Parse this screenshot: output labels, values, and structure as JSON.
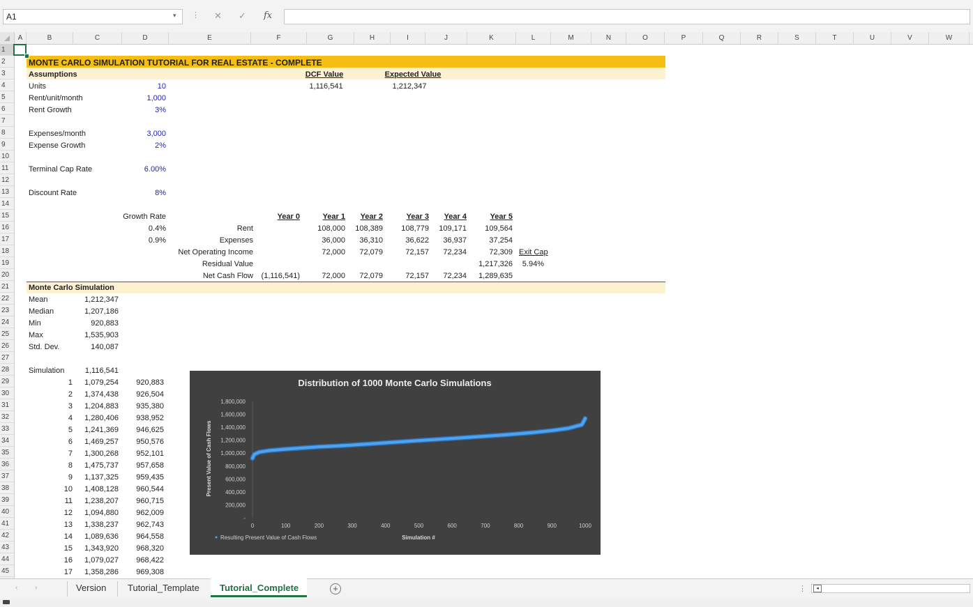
{
  "namebox": "A1",
  "formula": {
    "fx": "fx",
    "cancel_icon": "✕",
    "enter_icon": "✓",
    "value": ""
  },
  "columns": [
    "A",
    "B",
    "C",
    "D",
    "E",
    "F",
    "G",
    "H",
    "I",
    "J",
    "K",
    "L",
    "M",
    "N",
    "O",
    "P",
    "Q",
    "R",
    "S",
    "T",
    "U",
    "V",
    "W"
  ],
  "rows": [
    "1",
    "2",
    "3",
    "4",
    "5",
    "6",
    "7",
    "8",
    "9",
    "10",
    "11",
    "12",
    "13",
    "14",
    "15",
    "16",
    "17",
    "18",
    "19",
    "20",
    "21",
    "22",
    "23",
    "24",
    "25",
    "26",
    "27",
    "28",
    "29",
    "30",
    "31",
    "32",
    "33",
    "34",
    "35",
    "36",
    "37",
    "38",
    "39",
    "40",
    "41",
    "42",
    "43",
    "44",
    "45"
  ],
  "sheet": {
    "title": "MONTE CARLO SIMULATION TUTORIAL FOR REAL ESTATE - COMPLETE",
    "assumptions_header": "Assumptions",
    "dcf_label": "DCF Value",
    "dcf_value": "1,116,541",
    "expected_label": "Expected Value",
    "expected_value": "1,212,347",
    "assumptions": [
      {
        "label": "Units",
        "value": "10"
      },
      {
        "label": "Rent/unit/month",
        "value": "1,000"
      },
      {
        "label": "Rent Growth",
        "value": "3%"
      },
      {
        "label": "Expenses/month",
        "value": "3,000"
      },
      {
        "label": "Expense Growth",
        "value": "2%"
      },
      {
        "label": "Terminal Cap Rate",
        "value": "6.00%"
      },
      {
        "label": "Discount Rate",
        "value": "8%"
      }
    ],
    "growth_rate_label": "Growth Rate",
    "growth_rates": [
      "0.4%",
      "0.9%"
    ],
    "years": [
      "Year 0",
      "Year 1",
      "Year 2",
      "Year 3",
      "Year 4",
      "Year 5"
    ],
    "cashflow_rows": [
      {
        "label": "Rent",
        "values": [
          "",
          "108,000",
          "108,389",
          "108,779",
          "109,171",
          "109,564"
        ]
      },
      {
        "label": "Expenses",
        "values": [
          "",
          "36,000",
          "36,310",
          "36,622",
          "36,937",
          "37,254"
        ]
      },
      {
        "label": "Net Operating Income",
        "values": [
          "",
          "72,000",
          "72,079",
          "72,157",
          "72,234",
          "72,309"
        ]
      },
      {
        "label": "Residual Value",
        "values": [
          "",
          "",
          "",
          "",
          "",
          "1,217,326"
        ]
      },
      {
        "label": "Net Cash Flow",
        "values": [
          "(1,116,541)",
          "72,000",
          "72,079",
          "72,157",
          "72,234",
          "1,289,635"
        ]
      }
    ],
    "exit_cap_label": "Exit Cap",
    "exit_cap_value": "5.94%",
    "mc_header": "Monte Carlo Simulation",
    "stats": [
      {
        "label": "Mean",
        "value": "1,212,347"
      },
      {
        "label": "Median",
        "value": "1,207,186"
      },
      {
        "label": "Min",
        "value": "920,883"
      },
      {
        "label": "Max",
        "value": "1,535,903"
      },
      {
        "label": "Std. Dev.",
        "value": "140,087"
      }
    ],
    "simulation_label": "Simulation",
    "simulation_base": "1,116,541",
    "sims": [
      {
        "n": "1",
        "value": "1,079,254",
        "sorted": "920,883"
      },
      {
        "n": "2",
        "value": "1,374,438",
        "sorted": "926,504"
      },
      {
        "n": "3",
        "value": "1,204,883",
        "sorted": "935,380"
      },
      {
        "n": "4",
        "value": "1,280,406",
        "sorted": "938,952"
      },
      {
        "n": "5",
        "value": "1,241,369",
        "sorted": "946,625"
      },
      {
        "n": "6",
        "value": "1,469,257",
        "sorted": "950,576"
      },
      {
        "n": "7",
        "value": "1,300,268",
        "sorted": "952,101"
      },
      {
        "n": "8",
        "value": "1,475,737",
        "sorted": "957,658"
      },
      {
        "n": "9",
        "value": "1,137,325",
        "sorted": "959,435"
      },
      {
        "n": "10",
        "value": "1,408,128",
        "sorted": "960,544"
      },
      {
        "n": "11",
        "value": "1,238,207",
        "sorted": "960,715"
      },
      {
        "n": "12",
        "value": "1,094,880",
        "sorted": "962,009"
      },
      {
        "n": "13",
        "value": "1,338,237",
        "sorted": "962,743"
      },
      {
        "n": "14",
        "value": "1,089,636",
        "sorted": "964,558"
      },
      {
        "n": "15",
        "value": "1,343,920",
        "sorted": "968,320"
      },
      {
        "n": "16",
        "value": "1,079,027",
        "sorted": "968,422"
      },
      {
        "n": "17",
        "value": "1,358,286",
        "sorted": "969,308"
      }
    ]
  },
  "tabs": [
    "Version",
    "Tutorial_Template",
    "Tutorial_Complete"
  ],
  "active_tab": "Tutorial_Complete",
  "colors": {
    "accent": "#217346",
    "title_band": "#f6bd12",
    "section_band": "#fdf1d2",
    "input_blue": "#2323b9",
    "chart_bg": "#404040",
    "series": "#4ea3f0"
  },
  "chart_data": {
    "type": "line",
    "title": "Distribution of 1000 Monte Carlo Simulations",
    "xlabel": "Simulation #",
    "ylabel": "Present Value of Cash Flows",
    "legend": "Resulting Present Value of Cash Flows",
    "legend_position": "bottom-left",
    "xlim": [
      0,
      1000
    ],
    "ylim": [
      0,
      1800000
    ],
    "x_ticks": [
      "0",
      "100",
      "200",
      "300",
      "400",
      "500",
      "600",
      "700",
      "800",
      "900",
      "1000"
    ],
    "y_ticks": [
      "-",
      "200,000",
      "400,000",
      "600,000",
      "800,000",
      "1,000,000",
      "1,200,000",
      "1,400,000",
      "1,600,000",
      "1,800,000"
    ],
    "series": [
      {
        "name": "Resulting Present Value of Cash Flows",
        "x": [
          0,
          5,
          20,
          50,
          100,
          150,
          200,
          250,
          300,
          350,
          400,
          450,
          500,
          550,
          600,
          650,
          700,
          750,
          800,
          850,
          900,
          950,
          990,
          1000
        ],
        "y": [
          920883,
          980000,
          1015000,
          1040000,
          1062000,
          1080000,
          1098000,
          1110000,
          1125000,
          1142000,
          1160000,
          1178000,
          1195000,
          1212000,
          1228000,
          1245000,
          1262000,
          1280000,
          1300000,
          1322000,
          1350000,
          1385000,
          1440000,
          1535903
        ]
      }
    ],
    "grid": false
  }
}
